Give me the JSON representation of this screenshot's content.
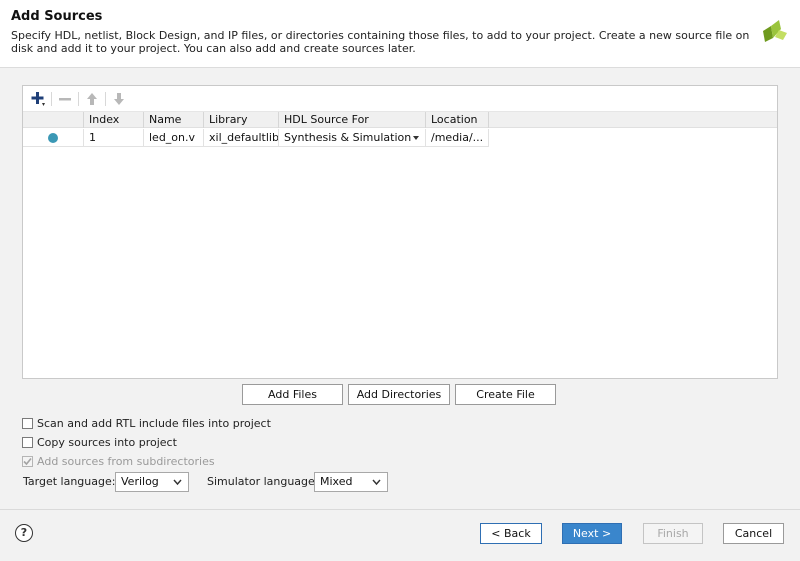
{
  "header": {
    "title": "Add Sources",
    "description": "Specify HDL, netlist, Block Design, and IP files, or directories containing those files, to add to your project. Create a new source file on disk and add it to your project. You can also add and create sources later.",
    "logo_colors": [
      "#9ac43c",
      "#6f9a1e",
      "#c3de62"
    ]
  },
  "toolbar": {
    "add_icon": "plus-icon",
    "remove_icon": "minus-icon",
    "up_icon": "arrow-up-icon",
    "down_icon": "arrow-down-icon"
  },
  "table": {
    "columns": [
      "",
      "Index",
      "Name",
      "Library",
      "HDL Source For",
      "Location"
    ],
    "rows": [
      {
        "index": "1",
        "name": "led_on.v",
        "library": "xil_defaultlib",
        "hdl_source_for": "Synthesis & Simulation",
        "location": "/media/..."
      }
    ]
  },
  "actions": {
    "add_files": "Add Files",
    "add_directories": "Add Directories",
    "create_file": "Create File"
  },
  "options": {
    "scan_rtl": {
      "label": "Scan and add RTL include files into project",
      "checked": false,
      "enabled": true
    },
    "copy_sources": {
      "label": "Copy sources into project",
      "checked": false,
      "enabled": true
    },
    "add_subdirs": {
      "label": "Add sources from subdirectories",
      "checked": true,
      "enabled": false
    }
  },
  "languages": {
    "target_label": "Target language:",
    "target_value": "Verilog",
    "simulator_label": "Simulator language:",
    "simulator_value": "Mixed"
  },
  "footer": {
    "help": "?",
    "back": "< Back",
    "next": "Next >",
    "finish": "Finish",
    "cancel": "Cancel"
  },
  "colors": {
    "accent": "#3a86cc",
    "status_dot": "#3b98b5"
  }
}
